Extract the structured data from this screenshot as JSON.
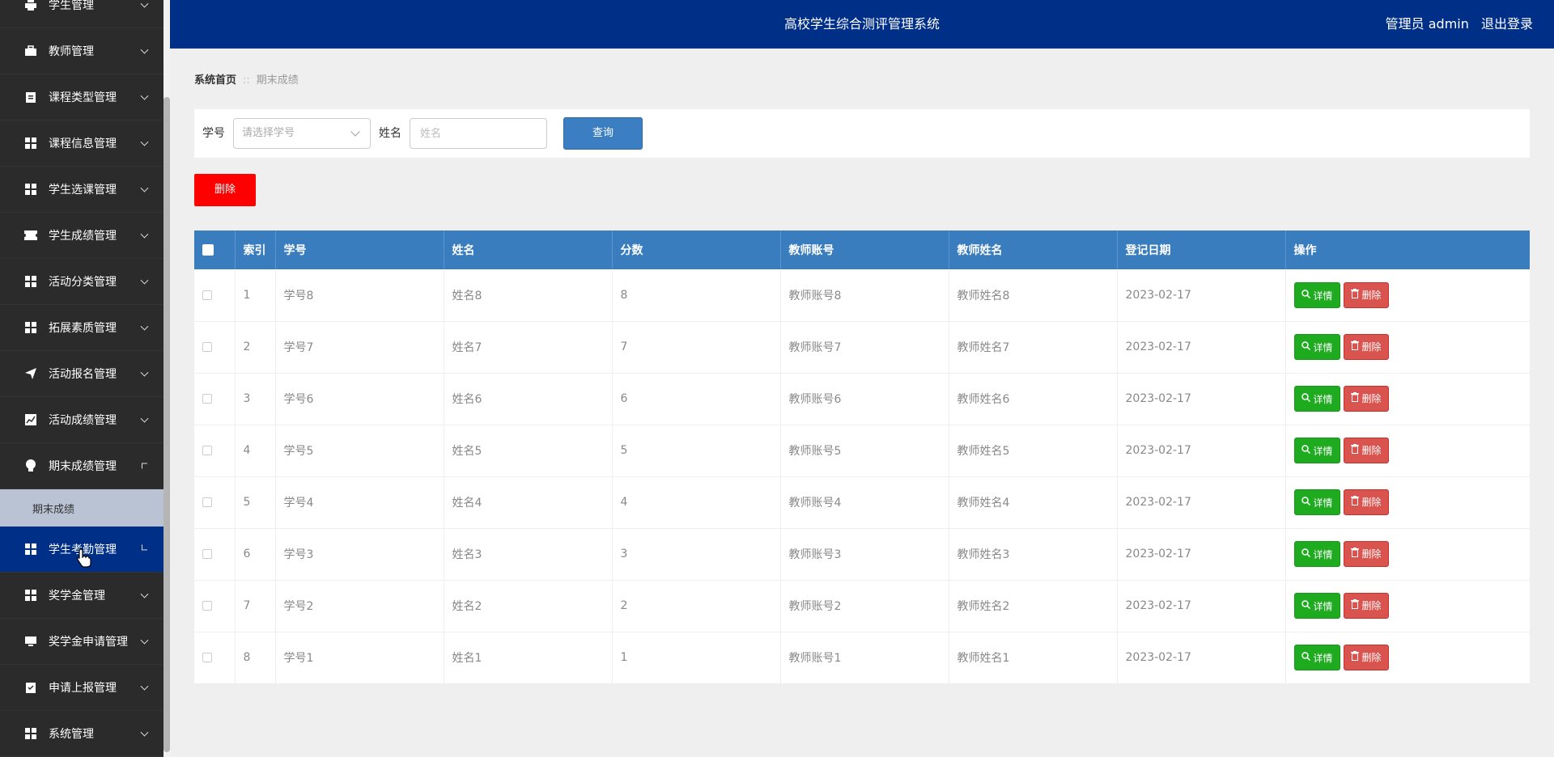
{
  "header": {
    "title": "高校学生综合测评管理系统",
    "user_label": "管理员 admin",
    "logout_label": "退出登录"
  },
  "sidebar": {
    "items": [
      {
        "label": "学生管理",
        "icon": "printer-icon"
      },
      {
        "label": "教师管理",
        "icon": "briefcase-icon"
      },
      {
        "label": "课程类型管理",
        "icon": "clipboard-icon"
      },
      {
        "label": "课程信息管理",
        "icon": "grid-icon"
      },
      {
        "label": "学生选课管理",
        "icon": "grid-icon"
      },
      {
        "label": "学生成绩管理",
        "icon": "ticket-icon"
      },
      {
        "label": "活动分类管理",
        "icon": "grid-icon"
      },
      {
        "label": "拓展素质管理",
        "icon": "grid-icon"
      },
      {
        "label": "活动报名管理",
        "icon": "paper-plane-icon"
      },
      {
        "label": "活动成绩管理",
        "icon": "chart-icon"
      },
      {
        "label": "期末成绩管理",
        "icon": "bulb-icon"
      },
      {
        "label": "学生考勤管理",
        "icon": "grid-icon"
      },
      {
        "label": "奖学金管理",
        "icon": "grid-icon"
      },
      {
        "label": "奖学金申请管理",
        "icon": "monitor-icon"
      },
      {
        "label": "申请上报管理",
        "icon": "clipboard-check-icon"
      },
      {
        "label": "系统管理",
        "icon": "grid-icon"
      }
    ],
    "submenu": {
      "label": "期末成绩"
    }
  },
  "breadcrumb": {
    "home": "系统首页",
    "separator": "::",
    "current": "期末成绩"
  },
  "search": {
    "student_id_label": "学号",
    "student_id_placeholder": "请选择学号",
    "name_label": "姓名",
    "name_placeholder": "姓名",
    "query_button": "查询"
  },
  "delete_button": "删除",
  "table": {
    "columns": [
      "索引",
      "学号",
      "姓名",
      "分数",
      "教师账号",
      "教师姓名",
      "登记日期",
      "操作"
    ],
    "detail_label": "详情",
    "remove_label": "删除",
    "rows": [
      {
        "index": "1",
        "student_id": "学号8",
        "name": "姓名8",
        "score": "8",
        "teacher_account": "教师账号8",
        "teacher_name": "教师姓名8",
        "date": "2023-02-17"
      },
      {
        "index": "2",
        "student_id": "学号7",
        "name": "姓名7",
        "score": "7",
        "teacher_account": "教师账号7",
        "teacher_name": "教师姓名7",
        "date": "2023-02-17"
      },
      {
        "index": "3",
        "student_id": "学号6",
        "name": "姓名6",
        "score": "6",
        "teacher_account": "教师账号6",
        "teacher_name": "教师姓名6",
        "date": "2023-02-17"
      },
      {
        "index": "4",
        "student_id": "学号5",
        "name": "姓名5",
        "score": "5",
        "teacher_account": "教师账号5",
        "teacher_name": "教师姓名5",
        "date": "2023-02-17"
      },
      {
        "index": "5",
        "student_id": "学号4",
        "name": "姓名4",
        "score": "4",
        "teacher_account": "教师账号4",
        "teacher_name": "教师姓名4",
        "date": "2023-02-17"
      },
      {
        "index": "6",
        "student_id": "学号3",
        "name": "姓名3",
        "score": "3",
        "teacher_account": "教师账号3",
        "teacher_name": "教师姓名3",
        "date": "2023-02-17"
      },
      {
        "index": "7",
        "student_id": "学号2",
        "name": "姓名2",
        "score": "2",
        "teacher_account": "教师账号2",
        "teacher_name": "教师姓名2",
        "date": "2023-02-17"
      },
      {
        "index": "8",
        "student_id": "学号1",
        "name": "姓名1",
        "score": "1",
        "teacher_account": "教师账号1",
        "teacher_name": "教师姓名1",
        "date": "2023-02-17"
      }
    ]
  },
  "colors": {
    "header_bg": "#002f87",
    "sidebar_bg": "#2b2b2b",
    "table_header_bg": "#3a7dbf",
    "detail_button": "#1fab1f",
    "remove_button": "#d9534f",
    "delete_button": "#ff0000"
  }
}
